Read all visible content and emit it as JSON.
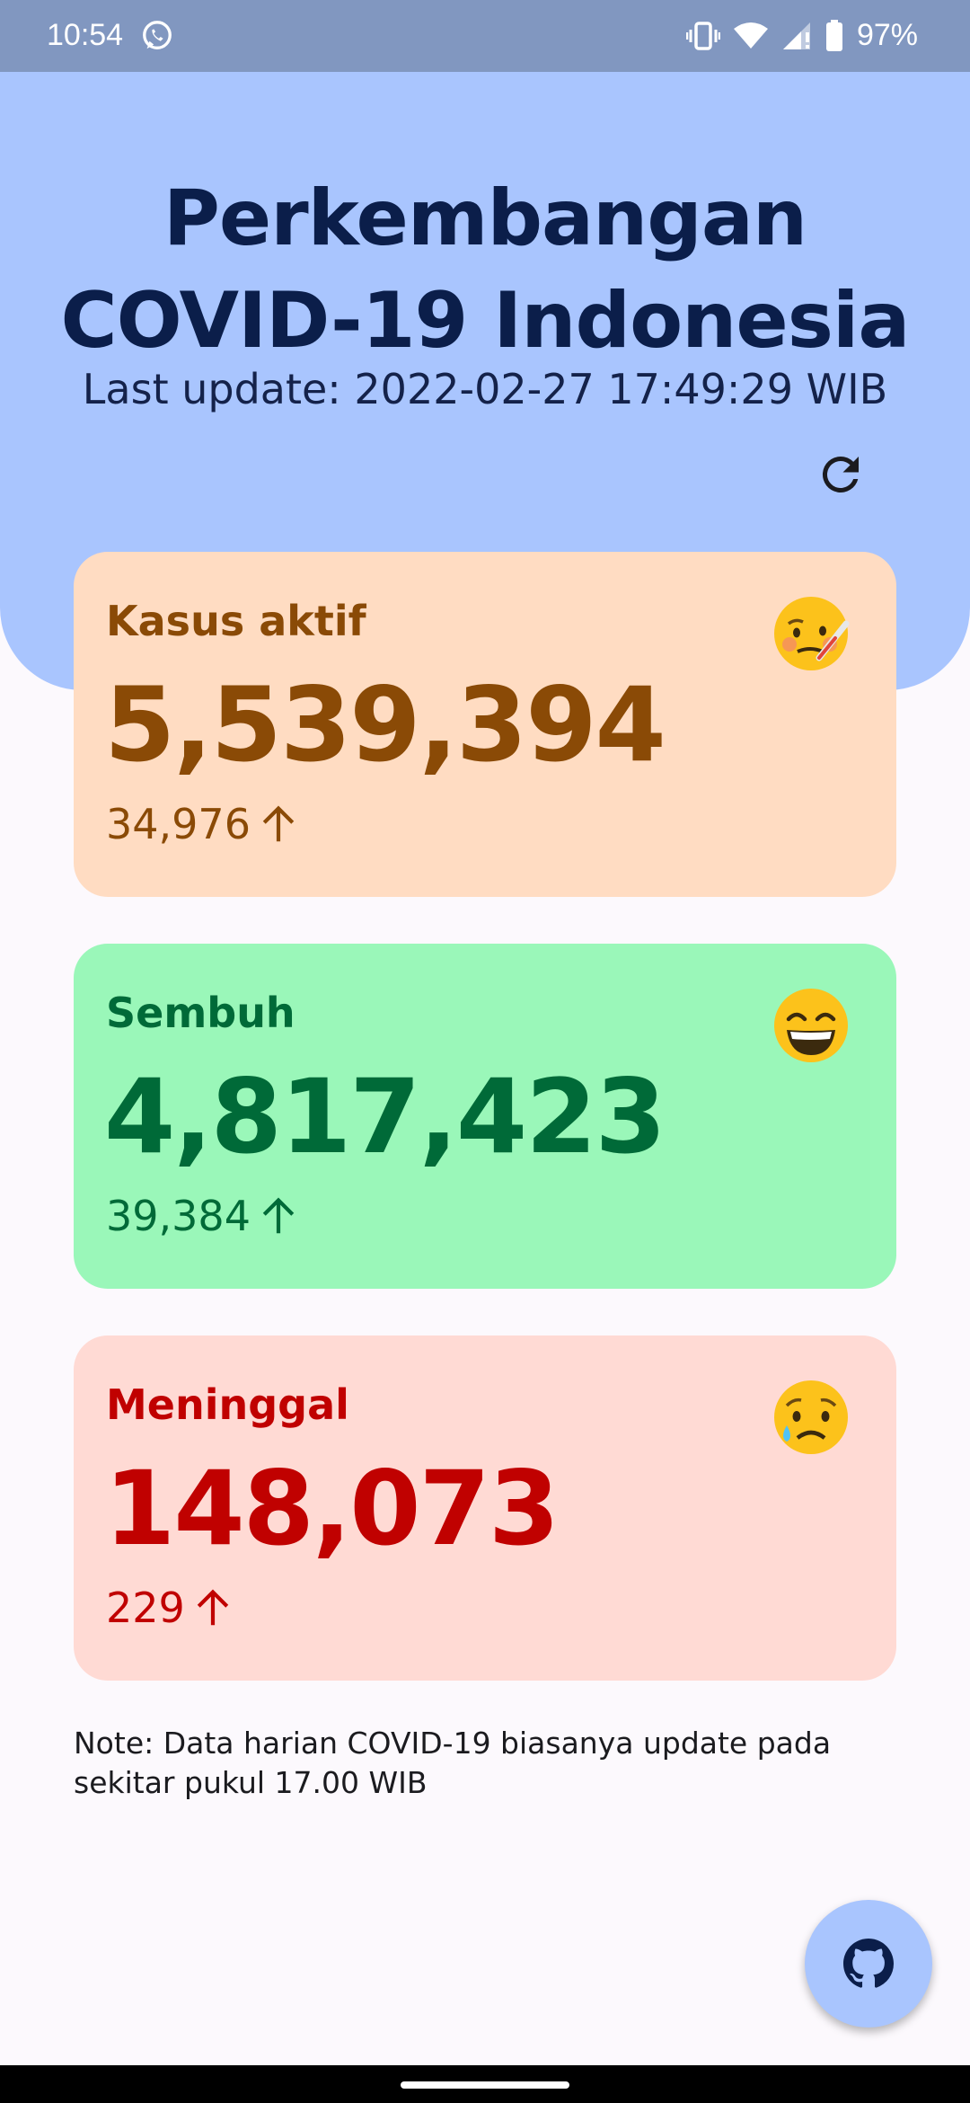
{
  "status_bar": {
    "time": "10:54",
    "battery": "97%",
    "icons": [
      "whatsapp-icon",
      "vibrate-icon",
      "wifi-icon",
      "signal-icon",
      "battery-icon"
    ]
  },
  "header": {
    "title_line1": "Perkembangan",
    "title_line2": "COVID-19 Indonesia",
    "last_update": "Last update: 2022-02-27 17:49:29 WIB",
    "background_color": "#a9c5fe",
    "refresh_icon": "refresh-icon"
  },
  "cards": [
    {
      "label": "Kasus aktif",
      "value": "5,539,394",
      "delta": "34,976",
      "delta_icon": "arrow-up-icon",
      "emoji": "face-with-thermometer-icon",
      "background_color": "#ffdcc2",
      "text_color": "#8a4a06"
    },
    {
      "label": "Sembuh",
      "value": "4,817,423",
      "delta": "39,384",
      "delta_icon": "arrow-up-icon",
      "emoji": "grinning-face-icon",
      "background_color": "#9af7b9",
      "text_color": "#006a38"
    },
    {
      "label": "Meninggal",
      "value": "148,073",
      "delta": "229",
      "delta_icon": "arrow-up-icon",
      "emoji": "crying-face-icon",
      "background_color": "#ffdad4",
      "text_color": "#c00100"
    }
  ],
  "note": "Note: Data harian COVID-19 biasanya update pada sekitar pukul 17.00 WIB",
  "fab": {
    "icon": "github-icon"
  }
}
